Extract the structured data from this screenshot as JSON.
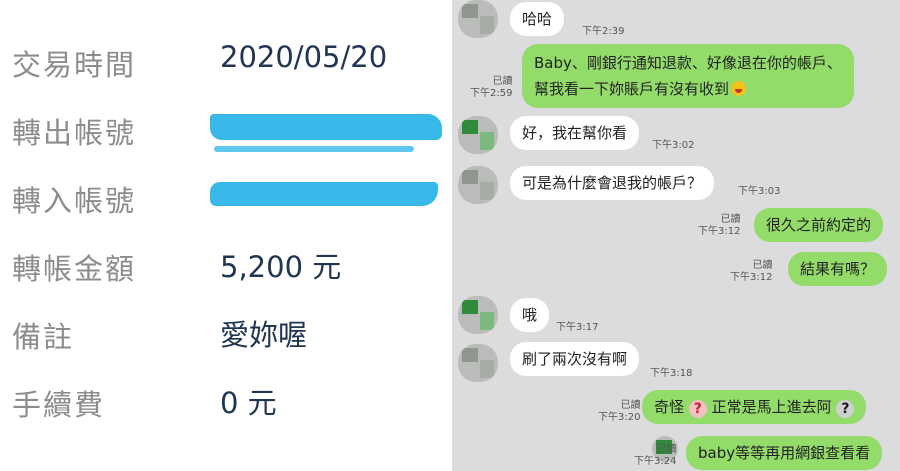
{
  "transfer": {
    "rows": [
      {
        "label": "交易時間",
        "value": "2020/05/20"
      },
      {
        "label": "轉出帳號",
        "value": ""
      },
      {
        "label": "轉入帳號",
        "value": ""
      },
      {
        "label": "轉帳金額",
        "value": "5,200 元"
      },
      {
        "label": "備註",
        "value": "愛妳喔"
      },
      {
        "label": "手續費",
        "value": "0 元"
      }
    ]
  },
  "chat": {
    "read_label": "已讀",
    "messages": [
      {
        "from": "them",
        "text": "哈哈",
        "time": "下午2:39"
      },
      {
        "from": "me",
        "line1": "Baby、剛銀行通知退款、好像退在你的帳戶、",
        "line2": "幫我看一下妳賬戶有沒有收到",
        "time": "下午2:59"
      },
      {
        "from": "them",
        "text": "好，我在幫你看",
        "time": "下午3:02"
      },
      {
        "from": "them",
        "text": "可是為什麼會退我的帳戶？",
        "time": "下午3:03"
      },
      {
        "from": "me",
        "text": "很久之前約定的",
        "time": "下午3:12"
      },
      {
        "from": "me",
        "text": "結果有嗎？",
        "time": "下午3:12"
      },
      {
        "from": "them",
        "text": "哦",
        "time": "下午3:17"
      },
      {
        "from": "them",
        "text": "刷了兩次沒有啊",
        "time": "下午3:18"
      },
      {
        "from": "me",
        "part1": "奇怪",
        "part2": "正常是馬上進去阿",
        "time": "下午3:20"
      },
      {
        "from": "me",
        "text": "baby等等再用網銀查看看",
        "time": "下午3:24"
      }
    ]
  },
  "colors": {
    "outgoing_bubble": "#93dc6a",
    "incoming_bubble": "#ffffff",
    "chat_background": "#dcdcde",
    "redaction": "#36b9e8",
    "value_text": "#1f3552",
    "label_text": "#8c8c8c"
  }
}
